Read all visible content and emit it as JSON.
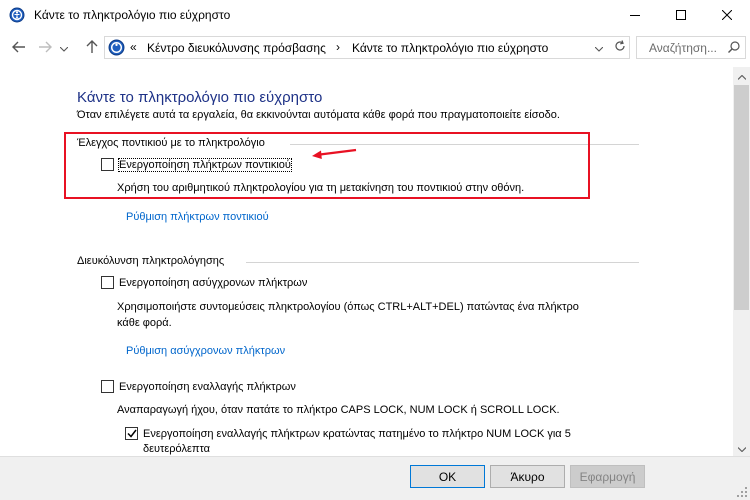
{
  "window": {
    "title": "Κάντε το πληκτρολόγιο πιο εύχρηστο",
    "minimize_icon": "minimize-icon",
    "maximize_icon": "maximize-icon",
    "close_icon": "close-icon"
  },
  "nav": {
    "address_chevron": "«",
    "breadcrumb": [
      "Κέντρο διευκόλυνσης πρόσβασης",
      "Κάντε το πληκτρολόγιο πιο εύχρηστο"
    ],
    "separator": "›",
    "search_placeholder": "Αναζήτηση..."
  },
  "page": {
    "title": "Κάντε το πληκτρολόγιο πιο εύχρηστο",
    "subtitle": "Όταν επιλέγετε αυτά τα εργαλεία, θα εκκινούνται αυτόματα κάθε φορά που πραγματοποιείτε είσοδο."
  },
  "mouse_group": {
    "heading": "Έλεγχος ποντικιού με το πληκτρολόγιο",
    "checkbox_label": "Ενεργοποίηση πλήκτρων ποντικιού",
    "checked": false,
    "description": "Χρήση του αριθμητικού πληκτρολογίου για τη μετακίνηση του ποντικιού στην οθόνη.",
    "link": "Ρύθμιση πλήκτρων ποντικιού"
  },
  "typing_group": {
    "heading": "Διευκόλυνση πληκτρολόγησης",
    "sticky": {
      "label": "Ενεργοποίηση ασύγχρονων πλήκτρων",
      "checked": false,
      "description_line1": "Χρησιμοποιήστε συντομεύσεις πληκτρολογίου (όπως CTRL+ALT+DEL) πατώντας ένα πλήκτρο",
      "description_line2": "κάθε φορά.",
      "link": "Ρύθμιση ασύγχρονων πλήκτρων"
    },
    "toggle": {
      "label": "Ενεργοποίηση εναλλαγής πλήκτρων",
      "checked": false,
      "description": "Αναπαραγωγή ήχου, όταν πατάτε το πλήκτρο CAPS LOCK, NUM LOCK ή SCROLL LOCK.",
      "sub_label_line1": "Ενεργοποίηση εναλλαγής πλήκτρων κρατώντας πατημένο το πλήκτρο NUM LOCK για 5",
      "sub_label_line2": "δευτερόλεπτα",
      "sub_checked": true
    }
  },
  "footer": {
    "ok": "OK",
    "cancel": "Άκυρο",
    "apply": "Εφαρμογή"
  },
  "colors": {
    "title_blue": "#1e3287",
    "link_blue": "#0066cc",
    "annotation_red": "#e81123"
  }
}
